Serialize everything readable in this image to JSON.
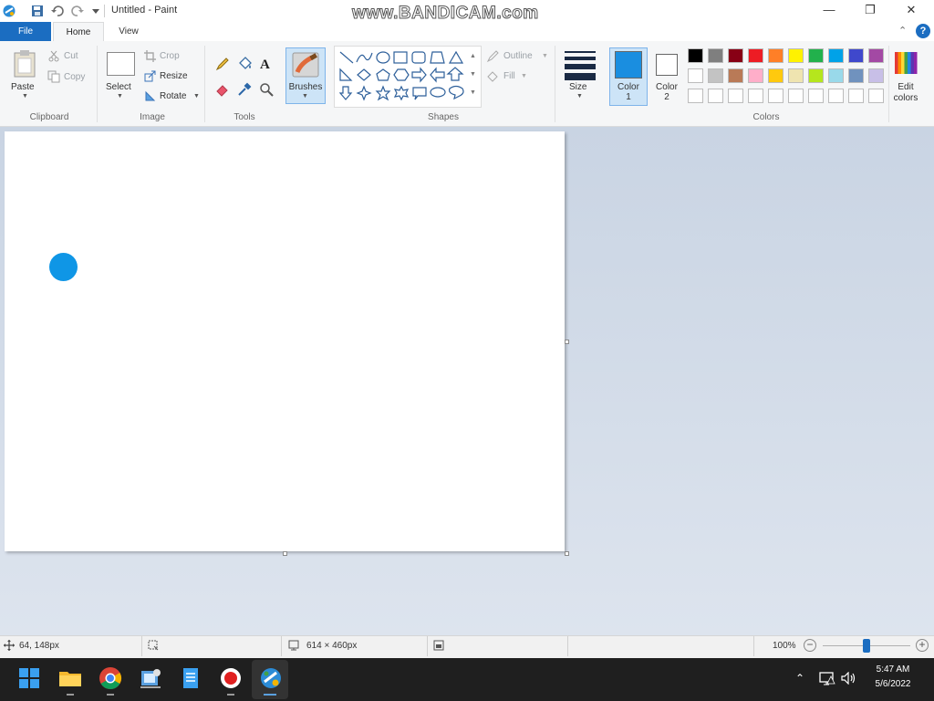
{
  "window": {
    "title": "Untitled - Paint",
    "watermark": "www.BANDICAM.com",
    "minimize": "—",
    "restore": "❐",
    "close": "✕",
    "collapse": "⌃",
    "help": "?"
  },
  "tabs": {
    "file": "File",
    "home": "Home",
    "view": "View"
  },
  "ribbon": {
    "clipboard": {
      "label": "Clipboard",
      "paste": "Paste",
      "cut": "Cut",
      "copy": "Copy"
    },
    "image": {
      "label": "Image",
      "select": "Select",
      "crop": "Crop",
      "resize": "Resize",
      "rotate": "Rotate"
    },
    "tools": {
      "label": "Tools"
    },
    "brushes": {
      "label": "Brushes"
    },
    "shapes": {
      "label": "Shapes",
      "outline": "Outline",
      "fill": "Fill"
    },
    "size": {
      "label": "Size"
    },
    "color1": {
      "label": "Color",
      "num": "1",
      "value": "#1a8ee0"
    },
    "color2": {
      "label": "Color",
      "num": "2",
      "value": "#ffffff"
    },
    "colors": {
      "label": "Colors",
      "edit_label": "Edit",
      "edit_label2": "colors",
      "row1": [
        "#000000",
        "#7f7f7f",
        "#880015",
        "#ed1c24",
        "#ff7f27",
        "#fff200",
        "#22b14c",
        "#00a2e8",
        "#3f48cc",
        "#a349a4"
      ],
      "row2": [
        "#ffffff",
        "#c3c3c3",
        "#b97a57",
        "#ffaec9",
        "#ffc90e",
        "#efe4b0",
        "#b5e61d",
        "#99d9ea",
        "#7092be",
        "#c8bfe7"
      ]
    }
  },
  "canvas": {
    "brush_color": "#0f96e6"
  },
  "status": {
    "cursor_pos": "64, 148px",
    "canvas_size": "614 × 460px",
    "zoom": "100%"
  },
  "taskbar": {
    "time": "5:47 AM",
    "date": "5/6/2022"
  }
}
